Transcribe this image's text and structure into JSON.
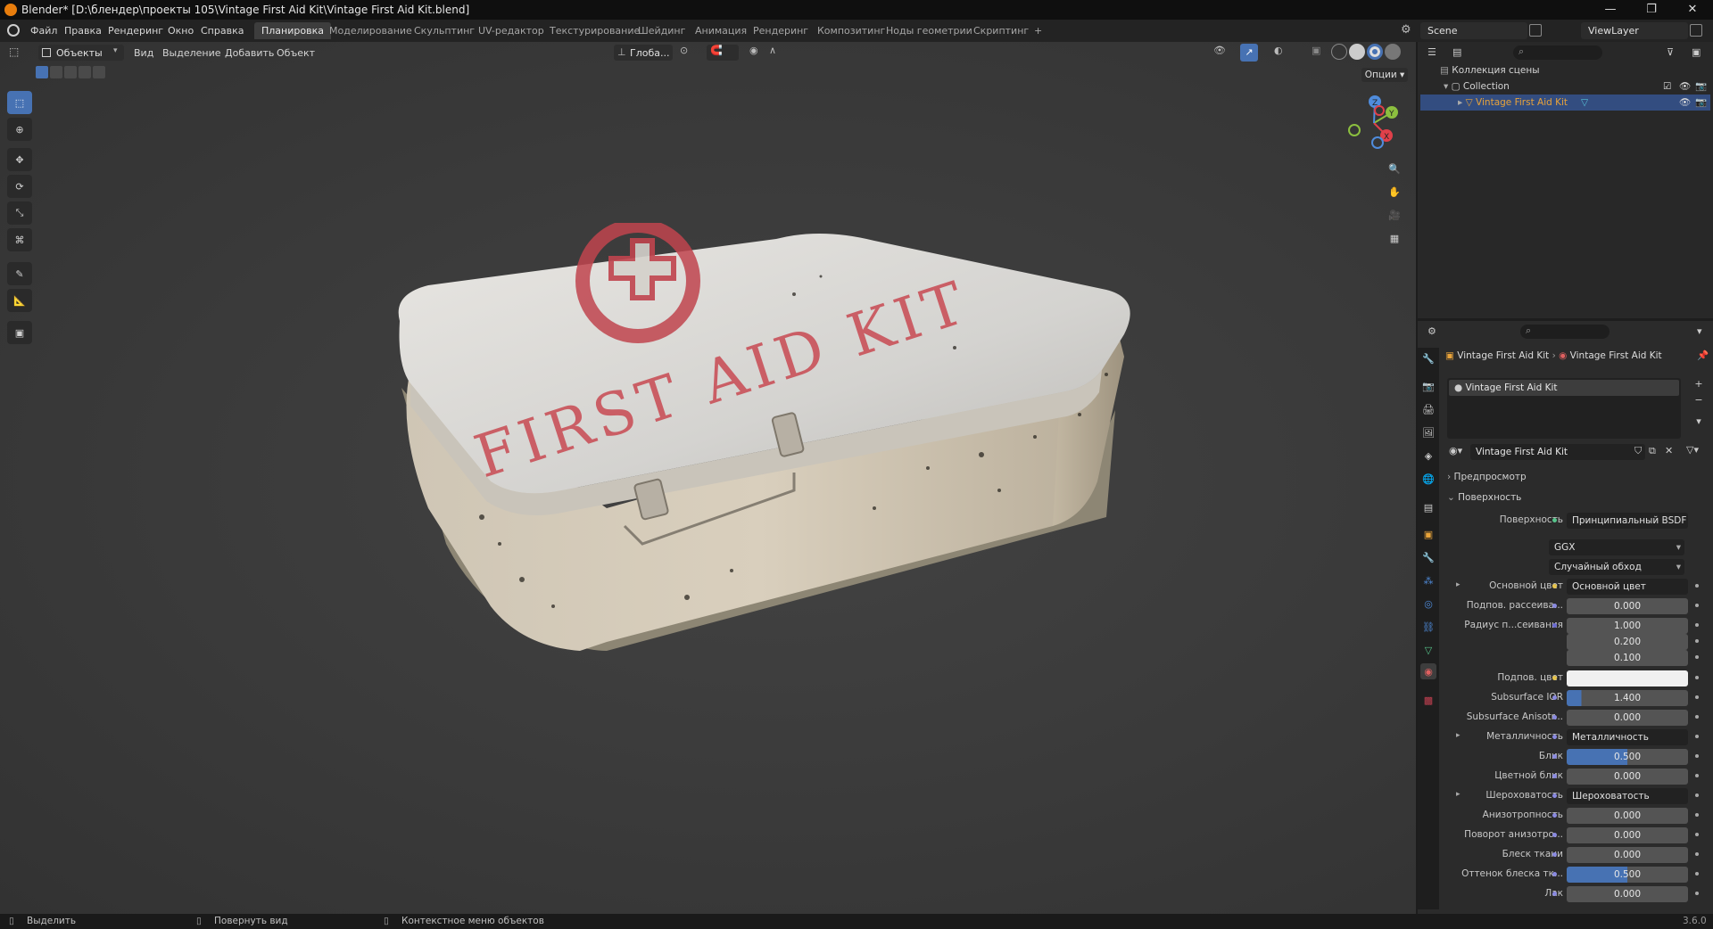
{
  "window": {
    "title": "Blender* [D:\\блендер\\проекты 105\\Vintage First Aid Kit\\Vintage First Aid Kit.blend]",
    "version": "3.6.0"
  },
  "menu": [
    "Файл",
    "Правка",
    "Рендеринг",
    "Окно",
    "Справка"
  ],
  "workspaces": [
    "Планировка",
    "Моделирование",
    "Скульптинг",
    "UV-редактор",
    "Текстурирование",
    "Шейдинг",
    "Анимация",
    "Рендеринг",
    "Композитинг",
    "Ноды геометрии",
    "Скриптинг",
    "+"
  ],
  "scene": {
    "name": "Scene",
    "view_layer": "ViewLayer"
  },
  "viewport": {
    "mode": "Объекты",
    "menus": [
      "Вид",
      "Выделение",
      "Добавить",
      "Объект"
    ],
    "transform_orientation": "Глоба...",
    "options": "Опции",
    "box": {
      "lid_text": "FIRST AID KIT"
    },
    "gizmo": {
      "x": "X",
      "y": "Y",
      "z": "Z"
    }
  },
  "outliner": {
    "scene_collection": "Коллекция сцены",
    "collection": "Collection",
    "object": "Vintage First Aid Kit"
  },
  "properties": {
    "breadcrumb": [
      "Vintage First Aid Kit",
      "Vintage First Aid Kit"
    ],
    "material_slot": "Vintage First Aid Kit",
    "material_name": "Vintage First Aid Kit",
    "panels": {
      "preview": "Предпросмотр",
      "surface": "Поверхность"
    },
    "surface_label": "Поверхность",
    "surface_value": "Принципиальный BSDF",
    "distribution": "GGX",
    "subsurface_method": "Случайный обход",
    "rows": [
      {
        "label": "Основной цвет",
        "value": "Основной цвет",
        "type": "link",
        "dot": "#e6c34a",
        "expand": true
      },
      {
        "label": "Подпов. рассеива...",
        "value": "0.000",
        "type": "num",
        "dot": "#8a8ae0"
      },
      {
        "label": "Радиус п...сеивания",
        "value": "1.000",
        "type": "num",
        "dot": "#6a6ad0"
      },
      {
        "label": "",
        "value": "0.200",
        "type": "num",
        "dot": ""
      },
      {
        "label": "",
        "value": "0.100",
        "type": "num",
        "dot": ""
      },
      {
        "label": "Подпов. цвет",
        "value": "",
        "type": "color",
        "dot": "#e6c34a"
      },
      {
        "label": "Subsurface IOR",
        "value": "1.400",
        "type": "num",
        "dot": "#8a8ae0",
        "fill": 0.12
      },
      {
        "label": "Subsurface Anisotr...",
        "value": "0.000",
        "type": "num",
        "dot": "#8a8ae0"
      },
      {
        "label": "Металличность",
        "value": "Металличность",
        "type": "link",
        "dot": "#8a8ae0",
        "expand": true
      },
      {
        "label": "Блик",
        "value": "0.500",
        "type": "num",
        "dot": "#8a8ae0",
        "fill": 0.5
      },
      {
        "label": "Цветной блик",
        "value": "0.000",
        "type": "num",
        "dot": "#8a8ae0"
      },
      {
        "label": "Шероховатость",
        "value": "Шероховатость",
        "type": "link",
        "dot": "#8a8ae0",
        "expand": true
      },
      {
        "label": "Анизотропность",
        "value": "0.000",
        "type": "num",
        "dot": "#8a8ae0"
      },
      {
        "label": "Поворот анизотро...",
        "value": "0.000",
        "type": "num",
        "dot": "#8a8ae0"
      },
      {
        "label": "Блеск ткани",
        "value": "0.000",
        "type": "num",
        "dot": "#8a8ae0"
      },
      {
        "label": "Оттенок блеска тк...",
        "value": "0.500",
        "type": "num",
        "dot": "#8a8ae0",
        "fill": 0.5
      },
      {
        "label": "Лак",
        "value": "0.000",
        "type": "num",
        "dot": "#8a8ae0"
      }
    ]
  },
  "status": {
    "select": "Выделить",
    "rotate": "Повернуть вид",
    "context": "Контекстное меню объектов"
  },
  "colors": {
    "accent": "#4772b3",
    "selected_object": "#e8a33a",
    "highlight_row": "#334d80"
  }
}
